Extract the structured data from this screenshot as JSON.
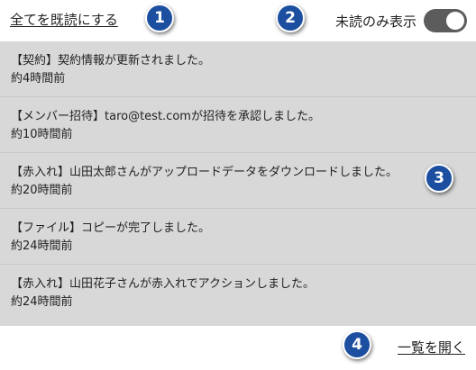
{
  "header": {
    "mark_all_read": "全てを既読にする",
    "unread_only_label": "未読のみ表示"
  },
  "notifications": [
    {
      "title": "【契約】契約情報が更新されました。",
      "time": "約4時間前"
    },
    {
      "title": "【メンバー招待】taro@test.comが招待を承認しました。",
      "time": "約10時間前"
    },
    {
      "title": "【赤入れ】山田太郎さんがアップロードデータをダウンロードしました。",
      "time": "約20時間前"
    },
    {
      "title": "【ファイル】コピーが完了しました。",
      "time": "約24時間前"
    },
    {
      "title": "【赤入れ】山田花子さんが赤入れでアクションしました。",
      "time": "約24時間前"
    }
  ],
  "footer": {
    "open_list": "一覧を開く"
  },
  "badges": [
    "1",
    "2",
    "3",
    "4"
  ],
  "toggle": {
    "on": true
  },
  "colors": {
    "badge": "#1d4fa0",
    "list_background": "#d8d8d8",
    "toggle": "#5c5c5c"
  }
}
